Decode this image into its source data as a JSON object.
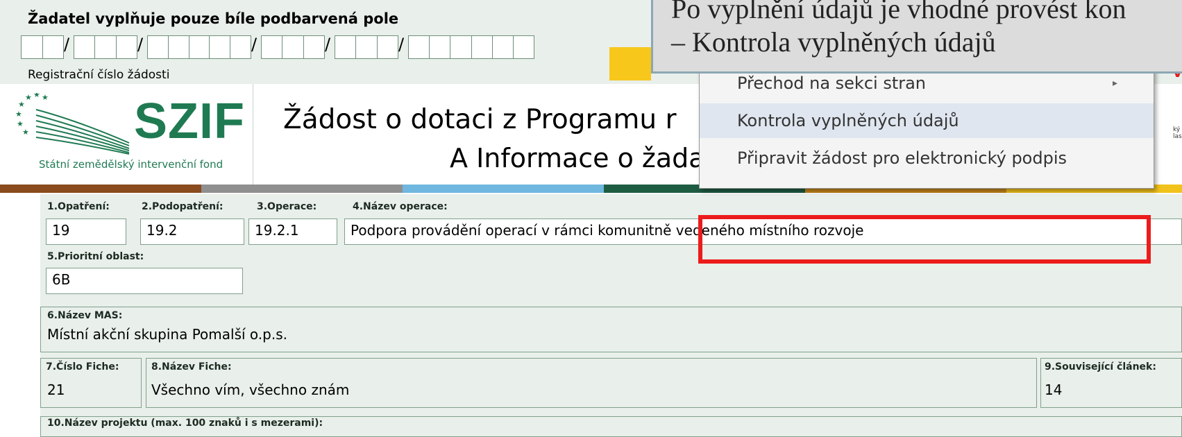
{
  "top": {
    "instruction": "Žadatel vyplňuje pouze bíle podbarvená pole",
    "registration_label": "Registrační číslo žádosti",
    "slash": "/"
  },
  "logo": {
    "brand": "SZIF",
    "subtitle": "Státní zemědělský intervenční fond",
    "color": "#1f7a52"
  },
  "document": {
    "title": "Žádost o dotaci z Programu r",
    "subtitle": "A Informace o žada"
  },
  "header_right": {
    "red_text": "voj",
    "small_text": "ký venko\nlasti"
  },
  "context_menu": {
    "items": [
      {
        "label": "Přechod na sekci stran",
        "has_submenu": true
      },
      {
        "label": "Kontrola vyplněných údajů",
        "highlighted": true
      },
      {
        "label": "Připravit žádost pro elektronický podpis"
      }
    ],
    "submenu_arrow": "▸"
  },
  "tooltip": {
    "line1": "Po vyplnění údajů je vhodné provést kon",
    "line2": "– Kontrola vyplněných údajů"
  },
  "stripe_colors": [
    "#8a4b1e",
    "#8f8f8f",
    "#6fb7df",
    "#1f5d43",
    "#c7871a",
    "#f2c21c"
  ],
  "form": {
    "fields": {
      "opatreni": {
        "label": "1.Opatření:",
        "value": "19"
      },
      "podopatreni": {
        "label": "2.Podopatření:",
        "value": "19.2"
      },
      "operace": {
        "label": "3.Operace:",
        "value": "19.2.1"
      },
      "nazev_operace": {
        "label": "4.Název operace:",
        "value": "Podpora provádění operací v rámci komunitně vedeného místního rozvoje"
      },
      "prioritni_oblast": {
        "label": "5.Prioritní oblast:",
        "value": "6B"
      },
      "nazev_mas": {
        "label": "6.Název MAS:",
        "value": "Místní akční skupina Pomalší o.p.s."
      },
      "cislo_fiche": {
        "label": "7.Číslo Fiche:",
        "value": "21"
      },
      "nazev_fiche": {
        "label": "8.Název Fiche:",
        "value": "Všechno vím, všechno znám"
      },
      "souvisejici_clanek": {
        "label": "9.Související článek:",
        "value": "14"
      },
      "nazev_projektu": {
        "label": "10.Název projektu (max. 100 znaků i s mezerami):"
      }
    }
  },
  "colors": {
    "highlight": "#ec1c1c",
    "form_background": "#e9efea",
    "yellow_button": "#f7c71c"
  }
}
